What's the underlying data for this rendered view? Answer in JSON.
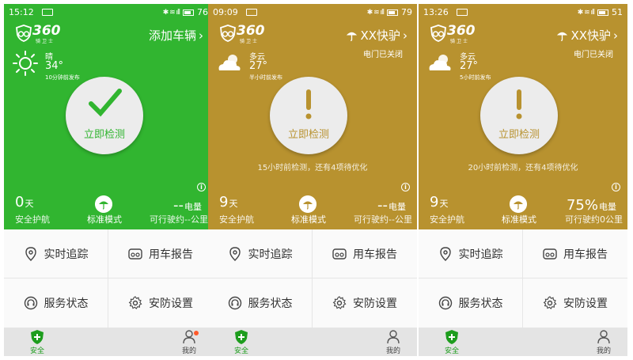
{
  "colors": {
    "green": "#31b530",
    "gold": "#b8922f",
    "tab_active": "#1d9d1d"
  },
  "screens": [
    {
      "theme": "green",
      "status": {
        "time": "15:12",
        "battery": "76"
      },
      "logo": {
        "text": "360",
        "sub": "骑卫士"
      },
      "top_right": "添加车辆",
      "top_right_icon": "chevron-right-icon",
      "door_status": "",
      "weather": {
        "icon": "sun-icon",
        "condition": "晴",
        "temp": "34°",
        "published": "10分钟前发布"
      },
      "check": {
        "icon": "checkmark-icon",
        "label": "立即检测"
      },
      "hint": "",
      "stats": {
        "days": "0",
        "days_unit": "天",
        "days_label": "安全护航",
        "mode_label": "标准模式",
        "battery_value": "--",
        "battery_unit": "电量",
        "range_label": "可行驶约--公里"
      },
      "menu": {
        "tracking": "实时追踪",
        "report": "用车报告",
        "service": "服务状态",
        "security": "安防设置"
      },
      "tabs": {
        "safety": "安全",
        "mine": "我的"
      },
      "has_notification": true
    },
    {
      "theme": "gold",
      "status": {
        "time": "09:09",
        "battery": "79"
      },
      "logo": {
        "text": "360",
        "sub": "骑卫士"
      },
      "top_right": "XX快驴",
      "top_right_icon": "umbrella-icon",
      "door_status": "电门已关闭",
      "weather": {
        "icon": "cloud-sun-icon",
        "condition": "多云",
        "temp": "27°",
        "published": "半小时前发布"
      },
      "check": {
        "icon": "exclamation-icon",
        "label": "立即检测"
      },
      "hint": "15小时前检测，还有4项待优化",
      "stats": {
        "days": "9",
        "days_unit": "天",
        "days_label": "安全护航",
        "mode_label": "标准模式",
        "battery_value": "--",
        "battery_unit": "电量",
        "range_label": "可行驶约--公里"
      },
      "menu": {
        "tracking": "实时追踪",
        "report": "用车报告",
        "service": "服务状态",
        "security": "安防设置"
      },
      "tabs": {
        "safety": "安全",
        "mine": "我的"
      },
      "has_notification": false
    },
    {
      "theme": "gold",
      "status": {
        "time": "13:26",
        "battery": "51"
      },
      "logo": {
        "text": "360",
        "sub": "骑卫士"
      },
      "top_right": "XX快驴",
      "top_right_icon": "umbrella-icon",
      "door_status": "电门已关闭",
      "weather": {
        "icon": "cloud-sun-icon",
        "condition": "多云",
        "temp": "27°",
        "published": "5小时前发布"
      },
      "check": {
        "icon": "exclamation-icon",
        "label": "立即检测"
      },
      "hint": "20小时前检测，还有4项待优化",
      "stats": {
        "days": "9",
        "days_unit": "天",
        "days_label": "安全护航",
        "mode_label": "标准模式",
        "battery_value": "75%",
        "battery_unit": "电量",
        "range_label": "可行驶约0公里"
      },
      "menu": {
        "tracking": "实时追踪",
        "report": "用车报告",
        "service": "服务状态",
        "security": "安防设置"
      },
      "tabs": {
        "safety": "安全",
        "mine": "我的"
      },
      "has_notification": false
    }
  ]
}
